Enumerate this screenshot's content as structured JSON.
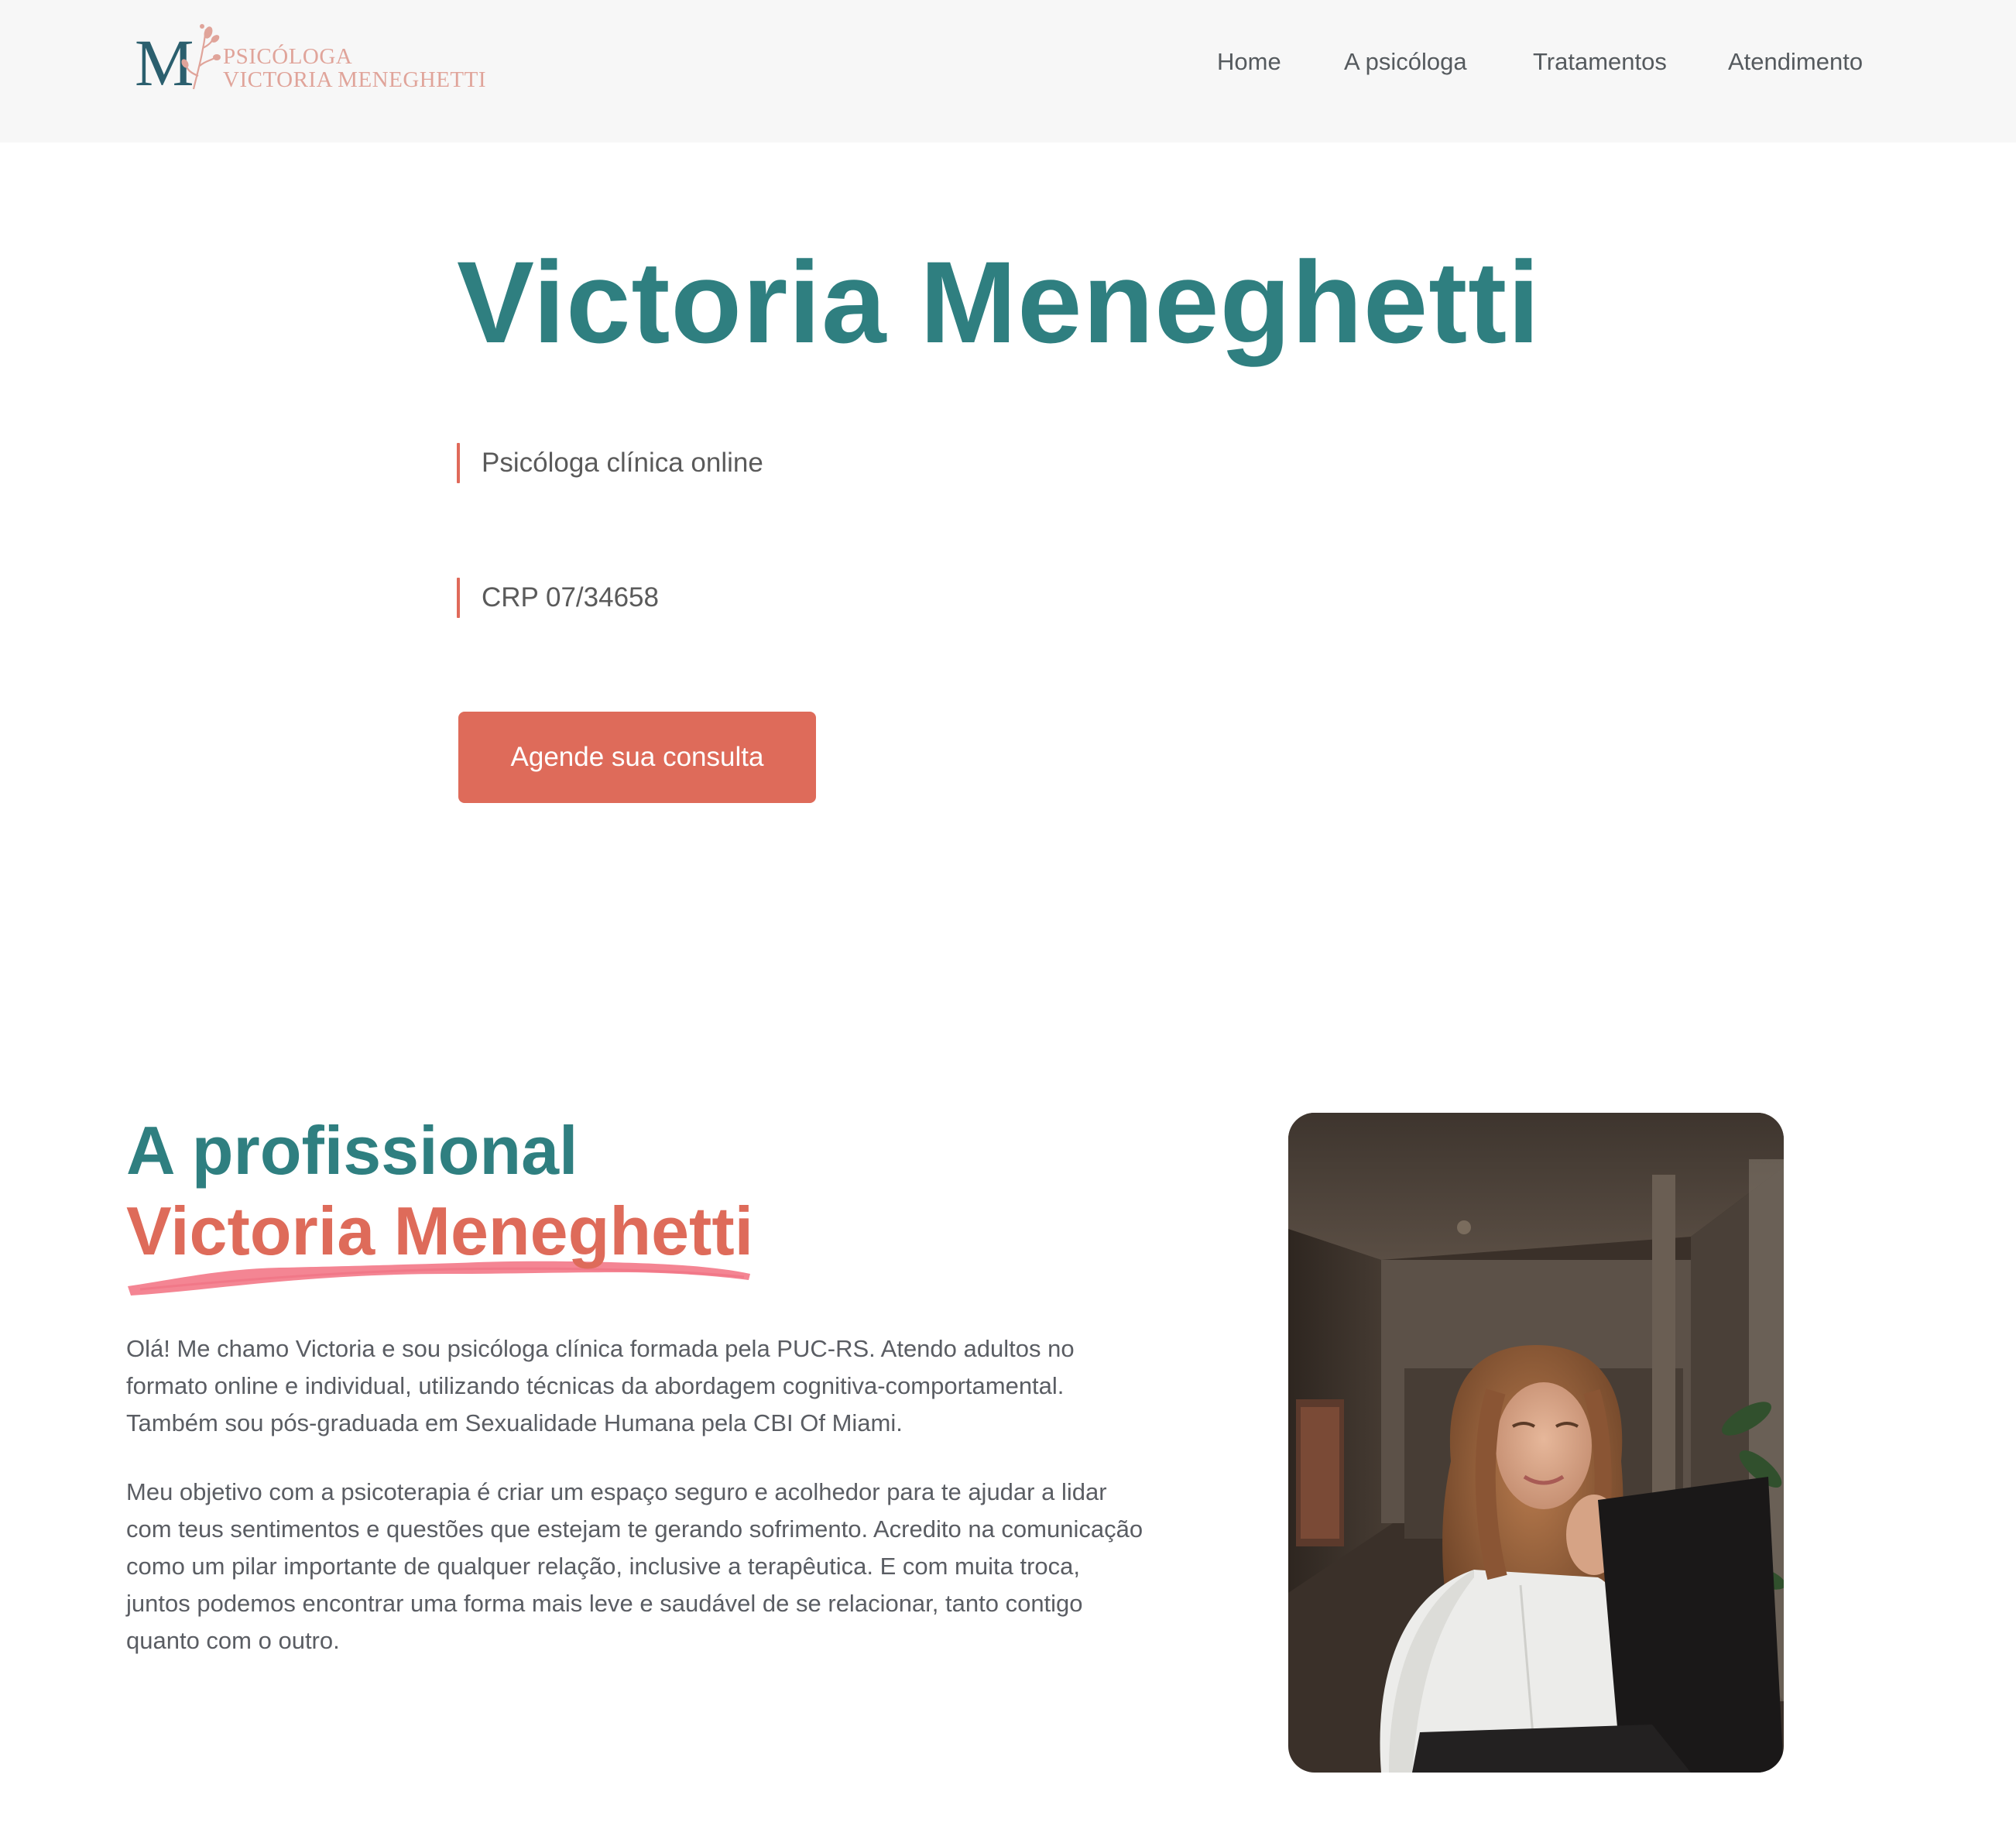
{
  "header": {
    "logo": {
      "monogram": "M",
      "line1": "PSICÓLOGA",
      "line2": "VICTORIA MENEGHETTI"
    },
    "nav": [
      "Home",
      "A psicóloga",
      "Tratamentos",
      "Atendimento"
    ]
  },
  "hero": {
    "title": "Victoria Meneghetti",
    "subtitle": "Psicóloga clínica online",
    "crp": "CRP 07/34658",
    "cta": "Agende sua consulta"
  },
  "about": {
    "heading": "A profissional",
    "name": "Victoria Meneghetti",
    "paragraphs": [
      "Olá! Me chamo Victoria e sou psicóloga clínica formada pela PUC-RS. Atendo adultos no formato online e individual, utilizando técnicas da abordagem cognitiva-comportamental. Também sou pós-graduada em Sexualidade Humana pela CBI Of Miami.",
      "Meu objetivo com a psicoterapia é criar um espaço seguro e acolhedor para te ajudar a lidar com teus sentimentos e questões que estejam te gerando sofrimento. Acredito na comunicação como um pilar importante de qualquer relação, inclusive a terapêutica. E com muita troca, juntos podemos encontrar uma forma mais leve e saudável de se relacionar, tanto contigo quanto com o outro."
    ]
  },
  "colors": {
    "teal": "#2f7f80",
    "coral": "#de6b5a",
    "header_bg": "#f7f7f7",
    "logo_pink": "#e0a49a",
    "underline_pink": "#f37b8a"
  }
}
